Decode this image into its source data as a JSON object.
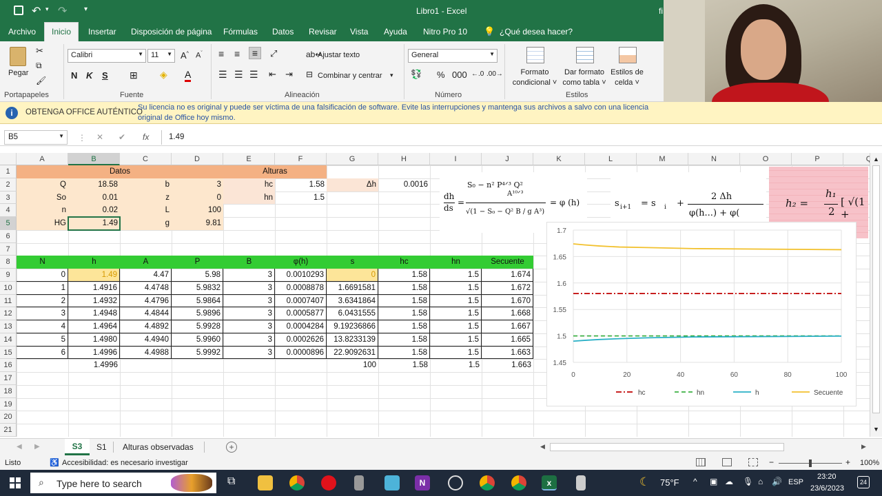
{
  "titlebar": {
    "title": "Libro1  -  Excel",
    "account_initial": "fi"
  },
  "menu": [
    "Archivo",
    "Inicio",
    "Insertar",
    "Disposición de página",
    "Fórmulas",
    "Datos",
    "Revisar",
    "Vista",
    "Ayuda",
    "Nitro Pro 10",
    "¿Qué desea hacer?"
  ],
  "ribbon": {
    "paste": "Pegar",
    "clipboard": "Portapapeles",
    "font_name": "Calibri",
    "font_size": "11",
    "font_group": "Fuente",
    "bold": "N",
    "italic": "K",
    "underline": "S",
    "wrap": "Ajustar texto",
    "merge": "Combinar y centrar",
    "align_group": "Alineación",
    "number_format": "General",
    "number_group": "Número",
    "percent": "%",
    "cond_format": [
      "Formato",
      "condicional ˅"
    ],
    "table_format": [
      "Dar formato",
      "como tabla ˅"
    ],
    "cell_styles": [
      "Estilos de",
      "celda ˅"
    ],
    "styles_group": "Estilos"
  },
  "infobar": {
    "title": "OBTENGA OFFICE AUTÉNTICO",
    "message": "Su licencia no es original y puede ser víctima de una falsificación de software. Evite las interrupciones y mantenga sus archivos a salvo con una licencia",
    "message2": "original de Office hoy mismo."
  },
  "formula_bar": {
    "name_box": "B5",
    "fx": "fx",
    "value": "1.49"
  },
  "columns": [
    "A",
    "B",
    "C",
    "D",
    "E",
    "F",
    "G",
    "H",
    "I",
    "J",
    "K",
    "L",
    "M",
    "N",
    "O",
    "P",
    "Q"
  ],
  "rows": [
    "1",
    "2",
    "3",
    "4",
    "5",
    "6",
    "7",
    "8",
    "9",
    "10",
    "11",
    "12",
    "13",
    "14",
    "15",
    "16",
    "17",
    "18",
    "19",
    "20",
    "21"
  ],
  "datos": {
    "header": "Datos",
    "labels": [
      "Q",
      "So",
      "n",
      "HG"
    ],
    "values": [
      "18.58",
      "0.01",
      "0.02",
      "1.49"
    ],
    "labels2": [
      "b",
      "z",
      "L",
      "g"
    ],
    "values2": [
      "3",
      "0",
      "100",
      "9.81"
    ]
  },
  "alturas": {
    "header": "Alturas",
    "labels": [
      "hc",
      "hn"
    ],
    "values": [
      "1.58",
      "1.5"
    ],
    "dh_label": "Δh",
    "dh_value": "0.0016"
  },
  "table": {
    "headers": [
      "N",
      "h",
      "A",
      "P",
      "B",
      "φ(h)",
      "s",
      "hc",
      "hn",
      "Secuente"
    ],
    "rows": [
      [
        "0",
        "1.49",
        "4.47",
        "5.98",
        "3",
        "0.0010293",
        "0",
        "1.58",
        "1.5",
        "1.674"
      ],
      [
        "1",
        "1.4916",
        "4.4748",
        "5.9832",
        "3",
        "0.0008878",
        "1.6691581",
        "1.58",
        "1.5",
        "1.672"
      ],
      [
        "2",
        "1.4932",
        "4.4796",
        "5.9864",
        "3",
        "0.0007407",
        "3.6341864",
        "1.58",
        "1.5",
        "1.670"
      ],
      [
        "3",
        "1.4948",
        "4.4844",
        "5.9896",
        "3",
        "0.0005877",
        "6.0431555",
        "1.58",
        "1.5",
        "1.668"
      ],
      [
        "4",
        "1.4964",
        "4.4892",
        "5.9928",
        "3",
        "0.0004284",
        "9.19236866",
        "1.58",
        "1.5",
        "1.667"
      ],
      [
        "5",
        "1.4980",
        "4.4940",
        "5.9960",
        "3",
        "0.0002626",
        "13.8233139",
        "1.58",
        "1.5",
        "1.665"
      ],
      [
        "6",
        "1.4996",
        "4.4988",
        "5.9992",
        "3",
        "0.0000896",
        "22.9092631",
        "1.58",
        "1.5",
        "1.663"
      ]
    ],
    "footer": {
      "h": "1.4996",
      "s": "100",
      "hc": "1.58",
      "hn": "1.5",
      "sec": "1.663"
    }
  },
  "formulas": {
    "f1_lhs_num": "dh",
    "f1_lhs_den": "ds",
    "f1_num": "S₀ − n² P⁴ᐟ³ Q²",
    "f1_num_den": "A¹⁰ᐟ³",
    "f1_den": "√(1 − S₀ − Q² B / g A³)",
    "f1_rhs": "= φ (h)",
    "f2": "s",
    "f2_sub": "i+1",
    "f2_eq": "= s",
    "f2_sub2": "i",
    "f2_plus": "+",
    "f2_num": "2  Δh",
    "f2_den": "φ(h...) + φ(",
    "f3": "h₂ =",
    "f3_num": "h₁",
    "f3_den": "2",
    "f3_tail": "[ √(1 +"
  },
  "chart_data": {
    "type": "line",
    "x": [
      0,
      4.2,
      9.7,
      17.2,
      27.6,
      44.9,
      100
    ],
    "xticks": [
      "0",
      "20",
      "40",
      "60",
      "80",
      "100"
    ],
    "yticks": [
      "1.45",
      "1.5",
      "1.55",
      "1.6",
      "1.65",
      "1.7"
    ],
    "xlim": [
      0,
      100
    ],
    "ylim": [
      1.45,
      1.7
    ],
    "series": [
      {
        "name": "hc",
        "values": [
          1.58,
          1.58,
          1.58,
          1.58,
          1.58,
          1.58,
          1.58
        ],
        "color": "#c00000",
        "style": "dashdot"
      },
      {
        "name": "hn",
        "values": [
          1.5,
          1.5,
          1.5,
          1.5,
          1.5,
          1.5,
          1.5
        ],
        "color": "#3cb043",
        "style": "dash"
      },
      {
        "name": "h",
        "values": [
          1.49,
          1.4916,
          1.4932,
          1.4948,
          1.4964,
          1.498,
          1.4996
        ],
        "color": "#2ab0c6",
        "style": "solid"
      },
      {
        "name": "Secuente",
        "values": [
          1.674,
          1.672,
          1.67,
          1.668,
          1.667,
          1.665,
          1.663
        ],
        "color": "#f2c12e",
        "style": "solid"
      }
    ],
    "legend": "bottom",
    "grid": true
  },
  "sheets": {
    "tabs": [
      "S3",
      "S1",
      "Alturas observadas"
    ],
    "active": "S3"
  },
  "status": {
    "ready": "Listo",
    "accessibility": "Accesibilidad: es necesario investigar",
    "zoom": "100%"
  },
  "taskbar": {
    "search": "Type here to search",
    "weather": "75°F",
    "lang": "ESP",
    "time": "23:20",
    "date": "23/6/2023",
    "notifications": "24"
  }
}
